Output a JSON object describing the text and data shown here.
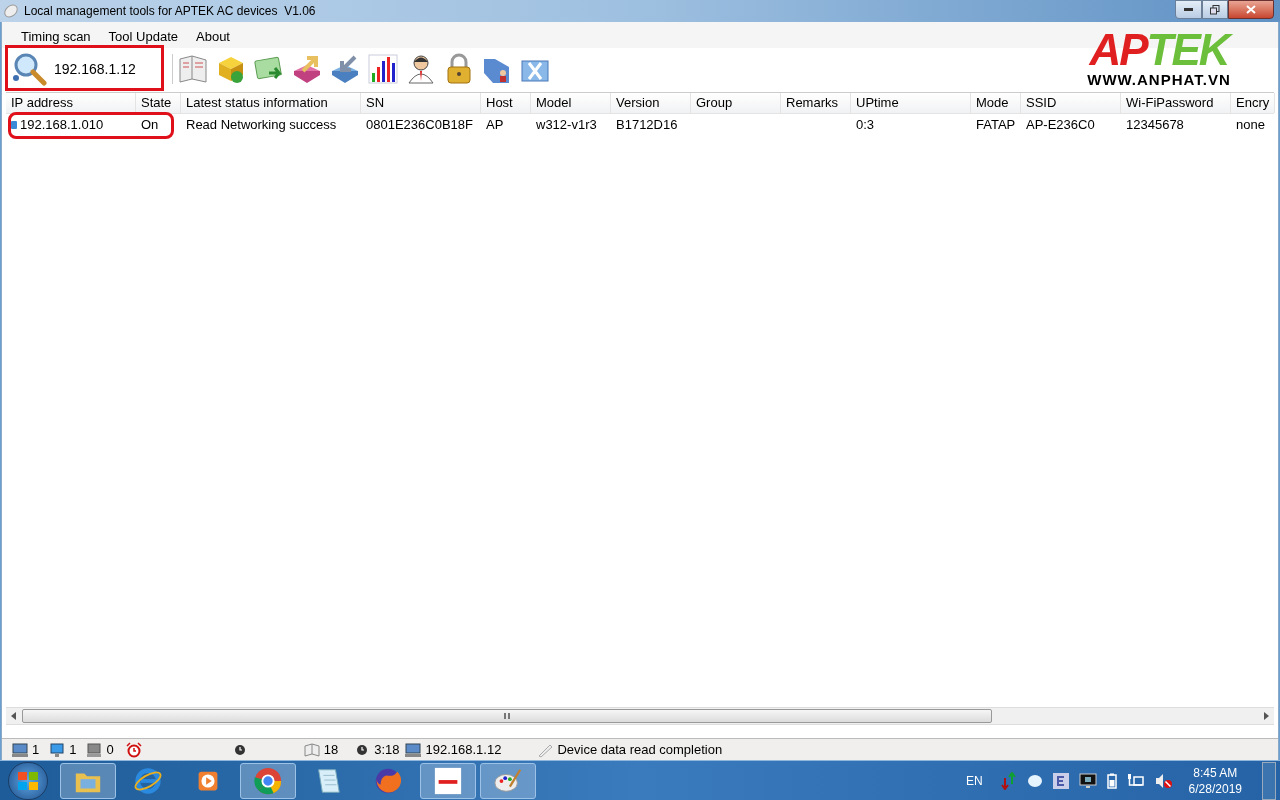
{
  "window": {
    "title": "Local management tools for APTEK AC devices  V1.06"
  },
  "menu": [
    "Timing scan",
    "Tool Update",
    "About"
  ],
  "toolbar": {
    "search_ip": "192.168.1.12",
    "tools": [
      {
        "kind": "book"
      },
      {
        "kind": "box"
      },
      {
        "kind": "card"
      },
      {
        "kind": "export"
      },
      {
        "kind": "import"
      },
      {
        "kind": "chart"
      },
      {
        "kind": "user"
      },
      {
        "kind": "lock"
      },
      {
        "kind": "folder-user"
      },
      {
        "kind": "folder-x"
      }
    ]
  },
  "logo": {
    "part_1": "AP",
    "part_2": "TEK",
    "url": "WWW.ANPHAT.VN"
  },
  "table": {
    "columns": [
      "IP address",
      "State",
      "Latest status information",
      "SN",
      "Host",
      "Model",
      "Version",
      "Group",
      "Remarks",
      "UPtime",
      "Mode",
      "SSID",
      "Wi-FiPassword",
      "Encry"
    ],
    "rows": [
      {
        "cells": [
          "192.168.1.010",
          "On",
          "Read Networking success",
          "0801E236C0B18F",
          "AP",
          "w312-v1r3",
          "B1712D16",
          "",
          "",
          "0:3",
          "FATAP",
          "AP-E236C0",
          "12345678",
          "none"
        ]
      }
    ]
  },
  "status_bar": [
    {
      "kind": "pc",
      "text": "1"
    },
    {
      "kind": "monitor",
      "text": "1"
    },
    {
      "kind": "grey-pc",
      "text": "0"
    },
    {
      "kind": "alarm"
    },
    {
      "kind": "clock"
    },
    {
      "kind": "book",
      "text": "18"
    },
    {
      "kind": "clock",
      "text": "3:18"
    },
    {
      "kind": "pc",
      "text": "192.168.1.12"
    },
    {
      "kind": "pen",
      "text": "Device data read completion"
    }
  ],
  "taskbar": {
    "apps": [
      {
        "kind": "folder",
        "active": true
      },
      {
        "kind": "ie",
        "active": false
      },
      {
        "kind": "media",
        "active": false
      },
      {
        "kind": "chrome",
        "active": true
      },
      {
        "kind": "notepad",
        "active": false
      },
      {
        "kind": "firefox",
        "active": false
      },
      {
        "kind": "aptek",
        "active": true
      },
      {
        "kind": "paint",
        "active": true
      }
    ],
    "language": "EN",
    "time": "8:45 AM",
    "date": "6/28/2019"
  }
}
